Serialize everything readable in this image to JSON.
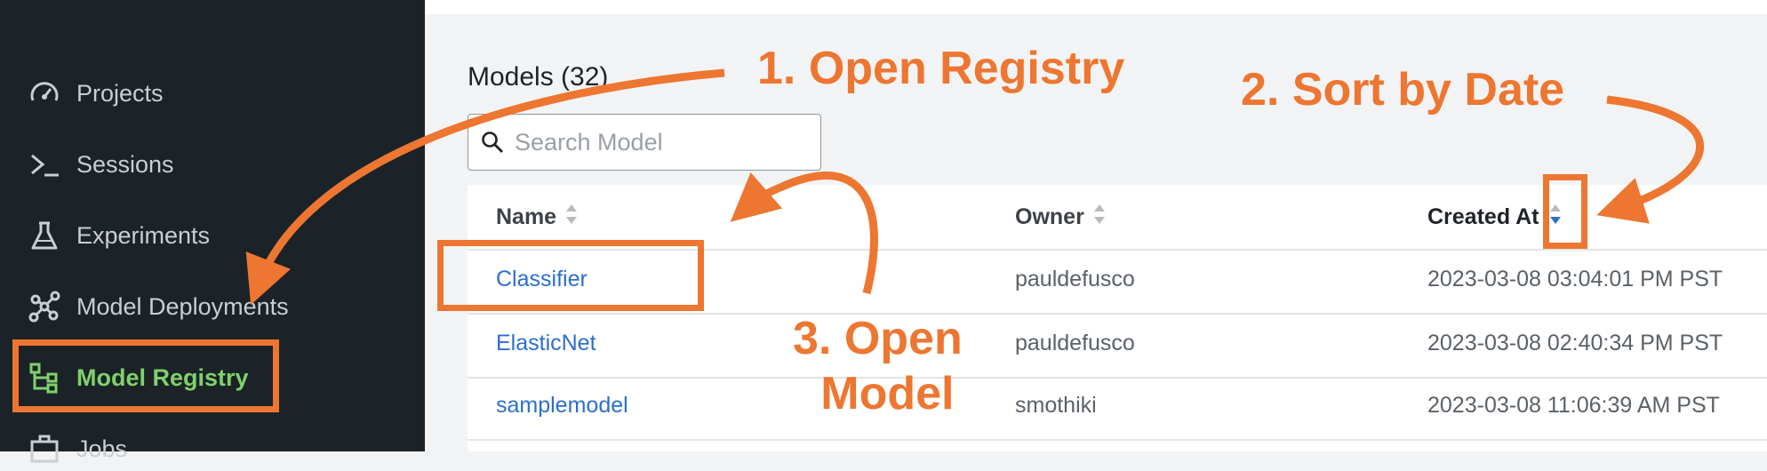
{
  "sidebar": {
    "items": [
      {
        "label": "Projects",
        "icon": "gauge-icon"
      },
      {
        "label": "Sessions",
        "icon": "terminal-icon"
      },
      {
        "label": "Experiments",
        "icon": "flask-icon"
      },
      {
        "label": "Model Deployments",
        "icon": "network-icon"
      },
      {
        "label": "Model Registry",
        "icon": "registry-tree-icon",
        "active": true
      },
      {
        "label": "Jobs",
        "icon": "briefcase-icon"
      }
    ]
  },
  "main": {
    "title": "Models (32)",
    "search": {
      "placeholder": "Search Model",
      "value": ""
    },
    "table": {
      "columns": [
        "Name",
        "Owner",
        "Created At"
      ],
      "rows": [
        {
          "name": "Classifier",
          "owner": "pauldefusco",
          "created": "2023-03-08 03:04:01 PM PST"
        },
        {
          "name": "ElasticNet",
          "owner": "pauldefusco",
          "created": "2023-03-08 02:40:34 PM PST"
        },
        {
          "name": "samplemodel",
          "owner": "smothiki",
          "created": "2023-03-08 11:06:39 AM PST"
        }
      ]
    }
  },
  "annotations": {
    "step1": "1. Open Registry",
    "step2": "2. Sort by Date",
    "step3_line1": "3. Open",
    "step3_line2": "Model"
  },
  "colors": {
    "sidebar_bg": "#1b2328",
    "active": "#7fd16a",
    "link": "#2a6fd0",
    "annotation": "#ed7631",
    "sort_active": "#2a6fd0"
  }
}
